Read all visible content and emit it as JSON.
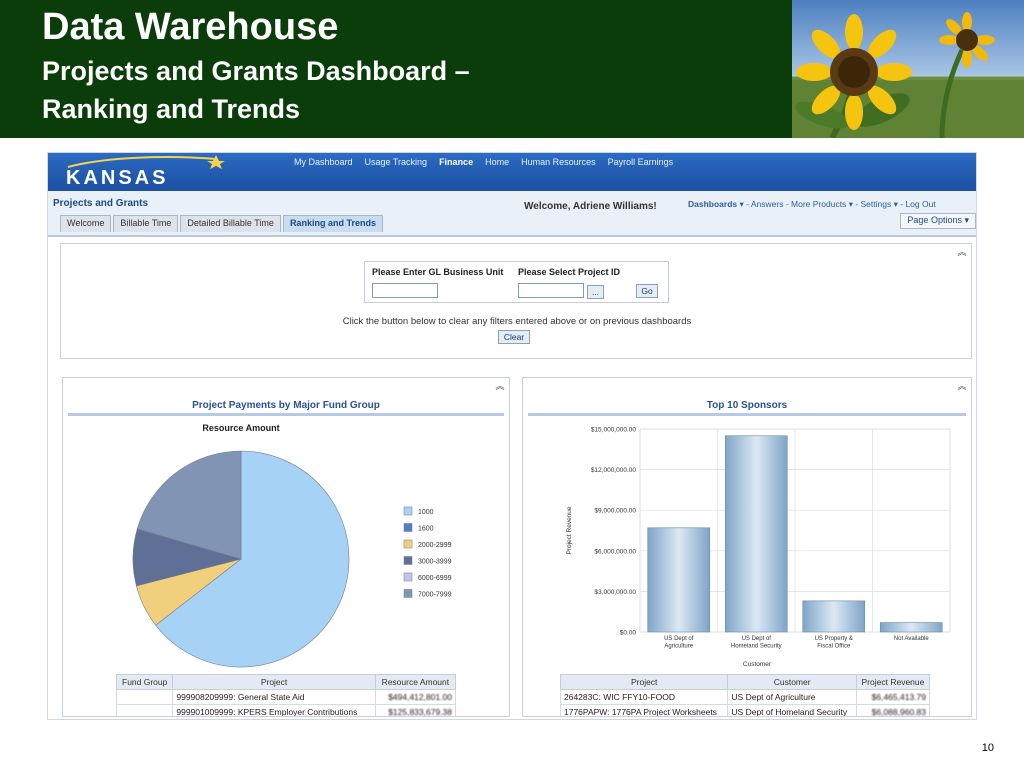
{
  "slide": {
    "title": "Data Warehouse",
    "subtitle_line1": "Projects and Grants Dashboard –",
    "subtitle_line2": "Ranking and Trends",
    "page_number": "10"
  },
  "app": {
    "logo": "KANSAS",
    "nav": [
      "My Dashboard",
      "Usage Tracking",
      "Finance",
      "Home",
      "Human Resources",
      "Payroll Earnings"
    ],
    "nav_active": "Finance",
    "section_title": "Projects and Grants",
    "welcome": "Welcome, Adriene Williams!",
    "links": {
      "dashboards": "Dashboards",
      "answers": "Answers",
      "more_products": "More Products",
      "settings": "Settings",
      "logout": "Log Out"
    },
    "tabs": [
      "Welcome",
      "Billable Time",
      "Detailed Billable Time",
      "Ranking and Trends"
    ],
    "active_tab": "Ranking and Trends",
    "page_options": "Page Options"
  },
  "filters": {
    "bu_label": "Please Enter GL Business Unit",
    "project_label": "Please Select Project ID",
    "browse_label": "...",
    "go_label": "Go",
    "clear_note": "Click the button below to clear any filters entered above or on previous dashboards",
    "clear_label": "Clear"
  },
  "colors": {
    "header_green": "#0b3d0b",
    "banner_blue": "#1b4fa1",
    "title_blue": "#2a4f9a"
  },
  "chart_data": [
    {
      "type": "pie",
      "panel_title": "Project Payments by Major Fund Group",
      "title": "Resource Amount",
      "legend_position": "right",
      "slices": [
        {
          "label": "1000",
          "value": 64.5,
          "color": "#a6d2f5"
        },
        {
          "label": "1600",
          "value": 0,
          "color": "#4f7fc4"
        },
        {
          "label": "2000-2999",
          "value": 6.5,
          "color": "#f2cf7c"
        },
        {
          "label": "3000-3999",
          "value": 8.5,
          "color": "#5f6f96"
        },
        {
          "label": "6000-6999",
          "value": 0,
          "color": "#c7c2e8"
        },
        {
          "label": "7000-7999",
          "value": 20.5,
          "color": "#8294b4"
        }
      ]
    },
    {
      "type": "bar",
      "panel_title": "Top 10 Sponsors",
      "xlabel": "Customer",
      "ylabel": "Project Revenue",
      "ylim": [
        0,
        15000000
      ],
      "yticks": [
        "$0.00",
        "$3,000,000.00",
        "$6,000,000.00",
        "$9,000,000.00",
        "$12,000,000.00",
        "$15,000,000.00"
      ],
      "categories": [
        "US Dept of Agriculture",
        "US Dept of Homeland Security",
        "US Property & Fiscal Office",
        "Not Available"
      ],
      "category_lines": [
        [
          "US Dept of",
          "Agriculture"
        ],
        [
          "US Dept of",
          "Homeland Security"
        ],
        [
          "US Property &",
          "Fiscal Office"
        ],
        [
          "Not Available"
        ]
      ],
      "values": [
        7700000,
        14500000,
        2300000,
        700000
      ]
    }
  ],
  "table_left": {
    "headers": [
      "Fund Group",
      "Project",
      "Resource Amount"
    ],
    "rows": [
      [
        "",
        "999908209999: General State Aid",
        "$494,412,801.00"
      ],
      [
        "",
        "999901009999: KPERS Employer Contributions",
        "$125,833,679.38"
      ]
    ]
  },
  "table_right": {
    "headers": [
      "Project",
      "Customer",
      "Project Revenue"
    ],
    "rows": [
      [
        "264283C: WIC FFY10-FOOD",
        "US Dept of Agriculture",
        "$6,465,413.79"
      ],
      [
        "1776PAPW: 1776PA Project Worksheets",
        "US Dept of Homeland Security",
        "$6,088,960.83"
      ]
    ]
  }
}
